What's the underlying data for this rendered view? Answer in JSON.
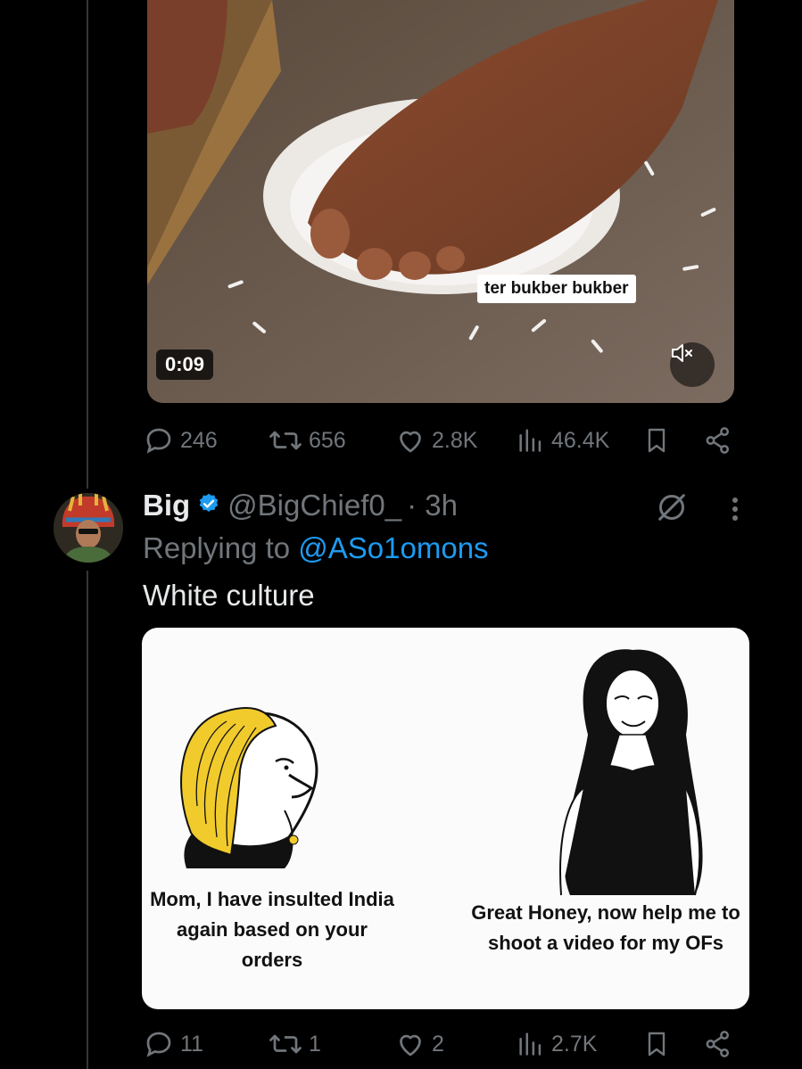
{
  "video": {
    "timestamp": "0:09",
    "caption": "ter bukber bukber",
    "mute_icon": "speaker-muted-icon"
  },
  "video_post_actions": {
    "replies": "246",
    "reposts": "656",
    "likes": "2.8K",
    "views": "46.4K"
  },
  "reply": {
    "display_name": "Big",
    "handle": "@BigChief0_",
    "time": "· 3h",
    "replying_prefix": "Replying to",
    "replying_to": "@ASo1omons",
    "text": "White culture",
    "meme": {
      "left_caption": "Mom, I have insulted India again based on your orders",
      "right_caption": "Great Honey, now help me to shoot a video for my OFs"
    },
    "actions": {
      "replies": "11",
      "reposts": "1",
      "likes": "2",
      "views": "2.7K"
    }
  },
  "colors": {
    "background": "#000000",
    "muted_text": "#71767b",
    "link": "#1d9bf0",
    "verified": "#1d9bf0"
  }
}
